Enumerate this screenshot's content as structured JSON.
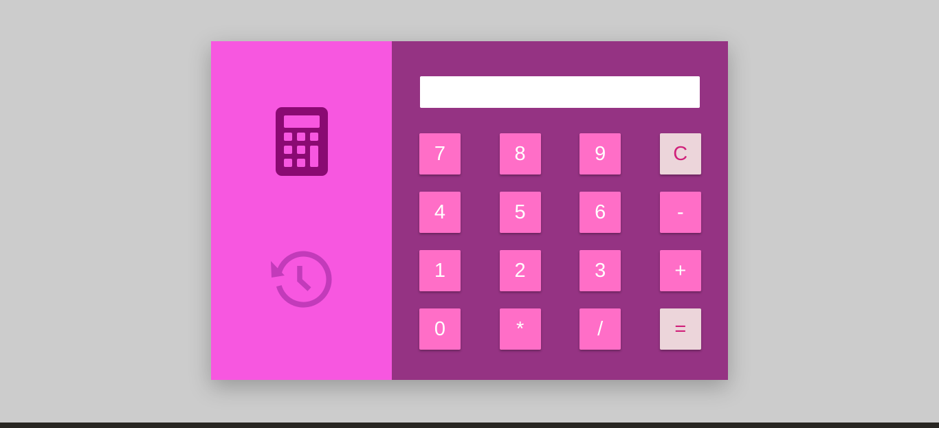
{
  "sidebar": {
    "icons": [
      {
        "name": "calculator-icon",
        "color": "#8a0a72"
      },
      {
        "name": "history-icon",
        "color": "#c23bba"
      }
    ]
  },
  "display": {
    "value": "",
    "placeholder": ""
  },
  "keypad": {
    "rows": [
      [
        "7",
        "8",
        "9",
        "C"
      ],
      [
        "4",
        "5",
        "6",
        "-"
      ],
      [
        "1",
        "2",
        "3",
        "+"
      ],
      [
        "0",
        "*",
        "/",
        "="
      ]
    ]
  },
  "colors": {
    "page_background": "#cccccc",
    "sidebar_background": "#f757e0",
    "panel_background": "#953383",
    "key_background": "#ff6ec7",
    "key_text": "#ffffff",
    "accent_key_background": "#ecd5da",
    "accent_key_text": "#d0217a"
  }
}
